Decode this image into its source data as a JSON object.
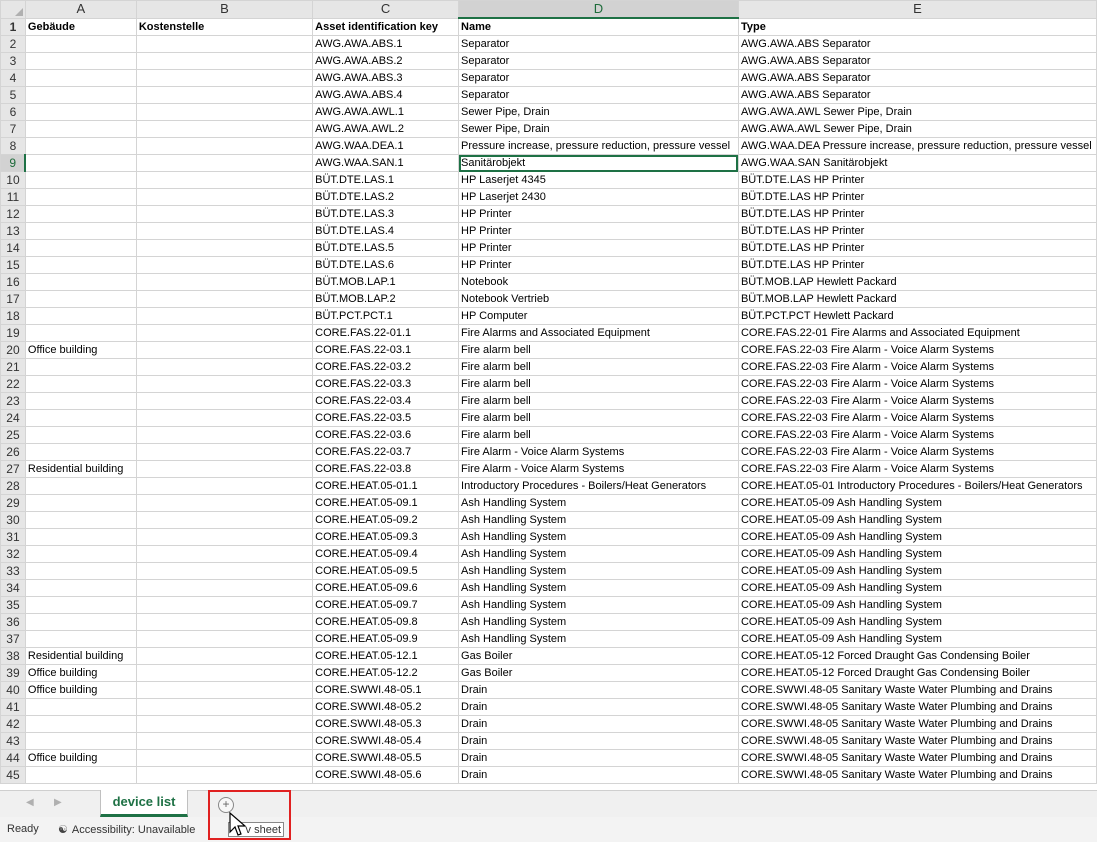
{
  "columns": [
    "A",
    "B",
    "C",
    "D",
    "E"
  ],
  "headers": [
    "Gebäude",
    "Kostenstelle",
    "Asset identification key",
    "Name",
    "Type"
  ],
  "rows": [
    {
      "n": "2",
      "a": "",
      "b": "",
      "c": "AWG.AWA.ABS.1",
      "d": "Separator",
      "e": "AWG.AWA.ABS Separator"
    },
    {
      "n": "3",
      "a": "",
      "b": "",
      "c": "AWG.AWA.ABS.2",
      "d": "Separator",
      "e": "AWG.AWA.ABS Separator"
    },
    {
      "n": "4",
      "a": "",
      "b": "",
      "c": "AWG.AWA.ABS.3",
      "d": "Separator",
      "e": "AWG.AWA.ABS Separator"
    },
    {
      "n": "5",
      "a": "",
      "b": "",
      "c": "AWG.AWA.ABS.4",
      "d": "Separator",
      "e": "AWG.AWA.ABS Separator"
    },
    {
      "n": "6",
      "a": "",
      "b": "",
      "c": "AWG.AWA.AWL.1",
      "d": "Sewer Pipe, Drain",
      "e": "AWG.AWA.AWL Sewer Pipe, Drain"
    },
    {
      "n": "7",
      "a": "",
      "b": "",
      "c": "AWG.AWA.AWL.2",
      "d": "Sewer Pipe, Drain",
      "e": "AWG.AWA.AWL Sewer Pipe, Drain"
    },
    {
      "n": "8",
      "a": "",
      "b": "",
      "c": "AWG.WAA.DEA.1",
      "d": "Pressure increase, pressure reduction, pressure vessel",
      "e": "AWG.WAA.DEA Pressure increase, pressure reduction, pressure vessel"
    },
    {
      "n": "9",
      "a": "",
      "b": "",
      "c": "AWG.WAA.SAN.1",
      "d": "Sanitärobjekt",
      "e": "AWG.WAA.SAN Sanitärobjekt"
    },
    {
      "n": "10",
      "a": "",
      "b": "",
      "c": "BÜT.DTE.LAS.1",
      "d": "HP Laserjet 4345",
      "e": "BÜT.DTE.LAS HP Printer"
    },
    {
      "n": "11",
      "a": "",
      "b": "",
      "c": "BÜT.DTE.LAS.2",
      "d": "HP Laserjet 2430",
      "e": "BÜT.DTE.LAS HP Printer"
    },
    {
      "n": "12",
      "a": "",
      "b": "",
      "c": "BÜT.DTE.LAS.3",
      "d": "HP Printer",
      "e": "BÜT.DTE.LAS HP Printer"
    },
    {
      "n": "13",
      "a": "",
      "b": "",
      "c": "BÜT.DTE.LAS.4",
      "d": "HP Printer",
      "e": "BÜT.DTE.LAS HP Printer"
    },
    {
      "n": "14",
      "a": "",
      "b": "",
      "c": "BÜT.DTE.LAS.5",
      "d": "HP Printer",
      "e": "BÜT.DTE.LAS HP Printer"
    },
    {
      "n": "15",
      "a": "",
      "b": "",
      "c": "BÜT.DTE.LAS.6",
      "d": "HP Printer",
      "e": "BÜT.DTE.LAS HP Printer"
    },
    {
      "n": "16",
      "a": "",
      "b": "",
      "c": "BÜT.MOB.LAP.1",
      "d": "Notebook",
      "e": "BÜT.MOB.LAP Hewlett Packard"
    },
    {
      "n": "17",
      "a": "",
      "b": "",
      "c": "BÜT.MOB.LAP.2",
      "d": "Notebook Vertrieb",
      "e": "BÜT.MOB.LAP Hewlett Packard"
    },
    {
      "n": "18",
      "a": "",
      "b": "",
      "c": "BÜT.PCT.PCT.1",
      "d": "HP Computer",
      "e": "BÜT.PCT.PCT Hewlett Packard"
    },
    {
      "n": "19",
      "a": "",
      "b": "",
      "c": "CORE.FAS.22-01.1",
      "d": "Fire Alarms and Associated Equipment",
      "e": "CORE.FAS.22-01 Fire Alarms and Associated Equipment"
    },
    {
      "n": "20",
      "a": "Office building",
      "b": "",
      "c": "CORE.FAS.22-03.1",
      "d": "Fire alarm bell",
      "e": "CORE.FAS.22-03 Fire Alarm - Voice Alarm Systems"
    },
    {
      "n": "21",
      "a": "",
      "b": "",
      "c": "CORE.FAS.22-03.2",
      "d": "Fire alarm bell",
      "e": "CORE.FAS.22-03 Fire Alarm - Voice Alarm Systems"
    },
    {
      "n": "22",
      "a": "",
      "b": "",
      "c": "CORE.FAS.22-03.3",
      "d": "Fire alarm bell",
      "e": "CORE.FAS.22-03 Fire Alarm - Voice Alarm Systems"
    },
    {
      "n": "23",
      "a": "",
      "b": "",
      "c": "CORE.FAS.22-03.4",
      "d": "Fire alarm bell",
      "e": "CORE.FAS.22-03 Fire Alarm - Voice Alarm Systems"
    },
    {
      "n": "24",
      "a": "",
      "b": "",
      "c": "CORE.FAS.22-03.5",
      "d": "Fire alarm bell",
      "e": "CORE.FAS.22-03 Fire Alarm - Voice Alarm Systems"
    },
    {
      "n": "25",
      "a": "",
      "b": "",
      "c": "CORE.FAS.22-03.6",
      "d": "Fire alarm bell",
      "e": "CORE.FAS.22-03 Fire Alarm - Voice Alarm Systems"
    },
    {
      "n": "26",
      "a": "",
      "b": "",
      "c": "CORE.FAS.22-03.7",
      "d": "Fire Alarm - Voice Alarm Systems",
      "e": "CORE.FAS.22-03 Fire Alarm - Voice Alarm Systems"
    },
    {
      "n": "27",
      "a": "Residential building",
      "b": "",
      "c": "CORE.FAS.22-03.8",
      "d": "Fire Alarm - Voice Alarm Systems",
      "e": "CORE.FAS.22-03 Fire Alarm - Voice Alarm Systems"
    },
    {
      "n": "28",
      "a": "",
      "b": "",
      "c": "CORE.HEAT.05-01.1",
      "d": "Introductory Procedures - Boilers/Heat Generators",
      "e": "CORE.HEAT.05-01 Introductory Procedures - Boilers/Heat Generators"
    },
    {
      "n": "29",
      "a": "",
      "b": "",
      "c": "CORE.HEAT.05-09.1",
      "d": "Ash Handling System",
      "e": "CORE.HEAT.05-09 Ash Handling System"
    },
    {
      "n": "30",
      "a": "",
      "b": "",
      "c": "CORE.HEAT.05-09.2",
      "d": "Ash Handling System",
      "e": "CORE.HEAT.05-09 Ash Handling System"
    },
    {
      "n": "31",
      "a": "",
      "b": "",
      "c": "CORE.HEAT.05-09.3",
      "d": "Ash Handling System",
      "e": "CORE.HEAT.05-09 Ash Handling System"
    },
    {
      "n": "32",
      "a": "",
      "b": "",
      "c": "CORE.HEAT.05-09.4",
      "d": "Ash Handling System",
      "e": "CORE.HEAT.05-09 Ash Handling System"
    },
    {
      "n": "33",
      "a": "",
      "b": "",
      "c": "CORE.HEAT.05-09.5",
      "d": "Ash Handling System",
      "e": "CORE.HEAT.05-09 Ash Handling System"
    },
    {
      "n": "34",
      "a": "",
      "b": "",
      "c": "CORE.HEAT.05-09.6",
      "d": "Ash Handling System",
      "e": "CORE.HEAT.05-09 Ash Handling System"
    },
    {
      "n": "35",
      "a": "",
      "b": "",
      "c": "CORE.HEAT.05-09.7",
      "d": "Ash Handling System",
      "e": "CORE.HEAT.05-09 Ash Handling System"
    },
    {
      "n": "36",
      "a": "",
      "b": "",
      "c": "CORE.HEAT.05-09.8",
      "d": "Ash Handling System",
      "e": "CORE.HEAT.05-09 Ash Handling System"
    },
    {
      "n": "37",
      "a": "",
      "b": "",
      "c": "CORE.HEAT.05-09.9",
      "d": "Ash Handling System",
      "e": "CORE.HEAT.05-09 Ash Handling System"
    },
    {
      "n": "38",
      "a": "Residential building",
      "b": "",
      "c": "CORE.HEAT.05-12.1",
      "d": "Gas Boiler",
      "e": "CORE.HEAT.05-12 Forced Draught Gas Condensing Boiler"
    },
    {
      "n": "39",
      "a": "Office building",
      "b": "",
      "c": "CORE.HEAT.05-12.2",
      "d": "Gas Boiler",
      "e": "CORE.HEAT.05-12 Forced Draught Gas Condensing Boiler"
    },
    {
      "n": "40",
      "a": "Office building",
      "b": "",
      "c": "CORE.SWWI.48-05.1",
      "d": "Drain",
      "e": "CORE.SWWI.48-05 Sanitary Waste Water Plumbing and Drains"
    },
    {
      "n": "41",
      "a": "",
      "b": "",
      "c": "CORE.SWWI.48-05.2",
      "d": "Drain",
      "e": "CORE.SWWI.48-05 Sanitary Waste Water Plumbing and Drains"
    },
    {
      "n": "42",
      "a": "",
      "b": "",
      "c": "CORE.SWWI.48-05.3",
      "d": "Drain",
      "e": "CORE.SWWI.48-05 Sanitary Waste Water Plumbing and Drains"
    },
    {
      "n": "43",
      "a": "",
      "b": "",
      "c": "CORE.SWWI.48-05.4",
      "d": "Drain",
      "e": "CORE.SWWI.48-05 Sanitary Waste Water Plumbing and Drains"
    },
    {
      "n": "44",
      "a": "Office building",
      "b": "",
      "c": "CORE.SWWI.48-05.5",
      "d": "Drain",
      "e": "CORE.SWWI.48-05 Sanitary Waste Water Plumbing and Drains"
    },
    {
      "n": "45",
      "a": "",
      "b": "",
      "c": "CORE.SWWI.48-05.6",
      "d": "Drain",
      "e": "CORE.SWWI.48-05 Sanitary Waste Water Plumbing and Drains"
    }
  ],
  "active_row": "9",
  "active_col": "D",
  "sheet_tab": "device list",
  "status": {
    "ready": "Ready",
    "accessibility": "Accessibility: Unavailable"
  },
  "tooltip": "v sheet",
  "icons": {
    "new_sheet": "plus-circle-icon",
    "accessibility": "accessibility-icon",
    "prev": "triangle-left-icon",
    "next": "triangle-right-icon",
    "cursor": "mouse-pointer-icon"
  },
  "colors": {
    "accent": "#1e7145",
    "highlight": "#e02020"
  }
}
